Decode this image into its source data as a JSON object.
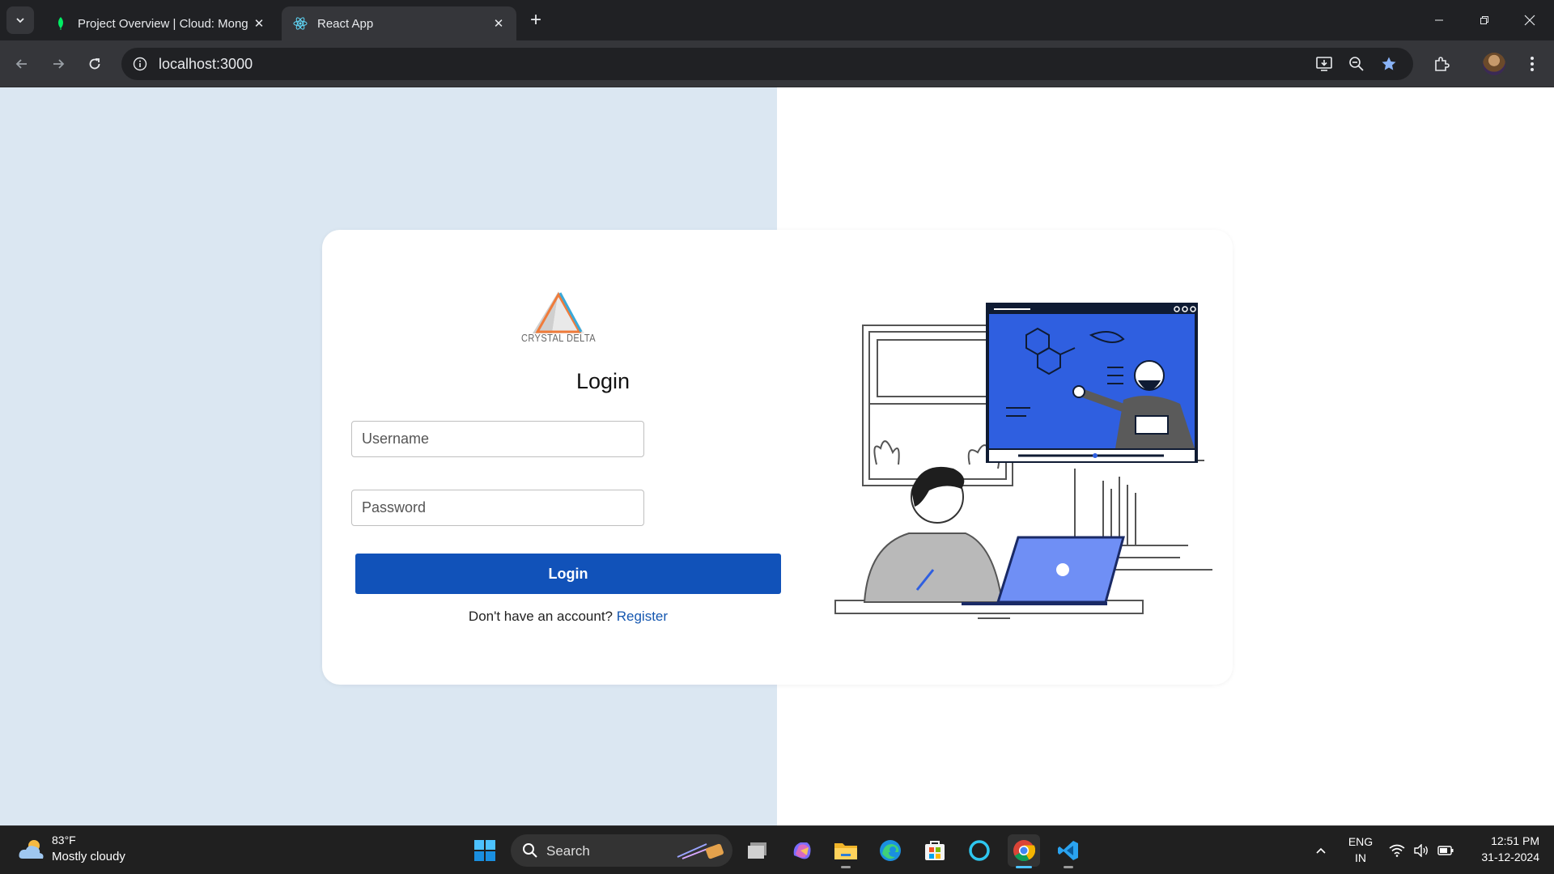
{
  "browser": {
    "tabs": [
      {
        "title": "Project Overview | Cloud: Mong",
        "favicon": "mongodb-leaf-icon",
        "active": false
      },
      {
        "title": "React App",
        "favicon": "react-icon",
        "active": true
      }
    ],
    "url": "localhost:3000"
  },
  "login": {
    "logo_text": "CRYSTAL DELTA",
    "title": "Login",
    "username_placeholder": "Username",
    "password_placeholder": "Password",
    "button_label": "Login",
    "register_prompt": "Don't have an account?",
    "register_link": "Register",
    "colors": {
      "primary": "#1152b9",
      "link": "#1557b0",
      "left_bg": "#dbe7f2"
    }
  },
  "taskbar": {
    "weather_temp": "83°F",
    "weather_desc": "Mostly cloudy",
    "search_label": "Search",
    "lang_line1": "ENG",
    "lang_line2": "IN",
    "time": "12:51 PM",
    "date": "31-12-2024"
  }
}
